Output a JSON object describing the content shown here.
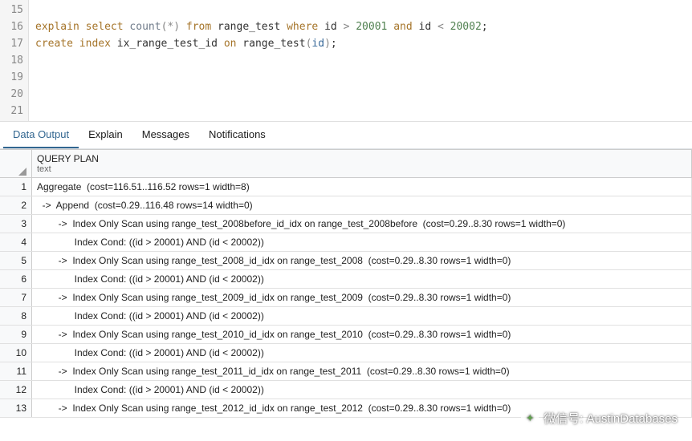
{
  "editor": {
    "lines": [
      {
        "num": "15",
        "tokens": []
      },
      {
        "num": "16",
        "tokens": [
          {
            "c": "kw",
            "t": "explain"
          },
          {
            "c": "black",
            "t": " "
          },
          {
            "c": "kw",
            "t": "select"
          },
          {
            "c": "black",
            "t": " "
          },
          {
            "c": "fn",
            "t": "count"
          },
          {
            "c": "paren",
            "t": "("
          },
          {
            "c": "star",
            "t": "*"
          },
          {
            "c": "paren",
            "t": ")"
          },
          {
            "c": "black",
            "t": " "
          },
          {
            "c": "kw",
            "t": "from"
          },
          {
            "c": "black",
            "t": " range_test "
          },
          {
            "c": "kw",
            "t": "where"
          },
          {
            "c": "black",
            "t": " id "
          },
          {
            "c": "op",
            "t": ">"
          },
          {
            "c": "black",
            "t": " "
          },
          {
            "c": "num",
            "t": "20001"
          },
          {
            "c": "black",
            "t": " "
          },
          {
            "c": "kw",
            "t": "and"
          },
          {
            "c": "black",
            "t": " id "
          },
          {
            "c": "op",
            "t": "<"
          },
          {
            "c": "black",
            "t": " "
          },
          {
            "c": "num",
            "t": "20002"
          },
          {
            "c": "black",
            "t": ";"
          }
        ]
      },
      {
        "num": "17",
        "tokens": [
          {
            "c": "kw",
            "t": "create"
          },
          {
            "c": "black",
            "t": " "
          },
          {
            "c": "kw",
            "t": "index"
          },
          {
            "c": "black",
            "t": " ix_range_test_id "
          },
          {
            "c": "kw",
            "t": "on"
          },
          {
            "c": "black",
            "t": " range_test"
          },
          {
            "c": "paren",
            "t": "("
          },
          {
            "c": "ident",
            "t": "id"
          },
          {
            "c": "paren",
            "t": ")"
          },
          {
            "c": "black",
            "t": ";"
          }
        ]
      },
      {
        "num": "18",
        "tokens": []
      },
      {
        "num": "19",
        "tokens": []
      },
      {
        "num": "20",
        "tokens": []
      },
      {
        "num": "21",
        "tokens": []
      }
    ]
  },
  "tabs": {
    "active": "Data Output",
    "items": [
      "Data Output",
      "Explain",
      "Messages",
      "Notifications"
    ]
  },
  "results": {
    "header": {
      "name": "QUERY PLAN",
      "type": "text"
    },
    "rows": [
      "Aggregate  (cost=116.51..116.52 rows=1 width=8)",
      "  ->  Append  (cost=0.29..116.48 rows=14 width=0)",
      "        ->  Index Only Scan using range_test_2008before_id_idx on range_test_2008before  (cost=0.29..8.30 rows=1 width=0)",
      "              Index Cond: ((id > 20001) AND (id < 20002))",
      "        ->  Index Only Scan using range_test_2008_id_idx on range_test_2008  (cost=0.29..8.30 rows=1 width=0)",
      "              Index Cond: ((id > 20001) AND (id < 20002))",
      "        ->  Index Only Scan using range_test_2009_id_idx on range_test_2009  (cost=0.29..8.30 rows=1 width=0)",
      "              Index Cond: ((id > 20001) AND (id < 20002))",
      "        ->  Index Only Scan using range_test_2010_id_idx on range_test_2010  (cost=0.29..8.30 rows=1 width=0)",
      "              Index Cond: ((id > 20001) AND (id < 20002))",
      "        ->  Index Only Scan using range_test_2011_id_idx on range_test_2011  (cost=0.29..8.30 rows=1 width=0)",
      "              Index Cond: ((id > 20001) AND (id < 20002))",
      "        ->  Index Only Scan using range_test_2012_id_idx on range_test_2012  (cost=0.29..8.30 rows=1 width=0)"
    ]
  },
  "watermark": {
    "text": "微信号: AustinDatabases"
  }
}
